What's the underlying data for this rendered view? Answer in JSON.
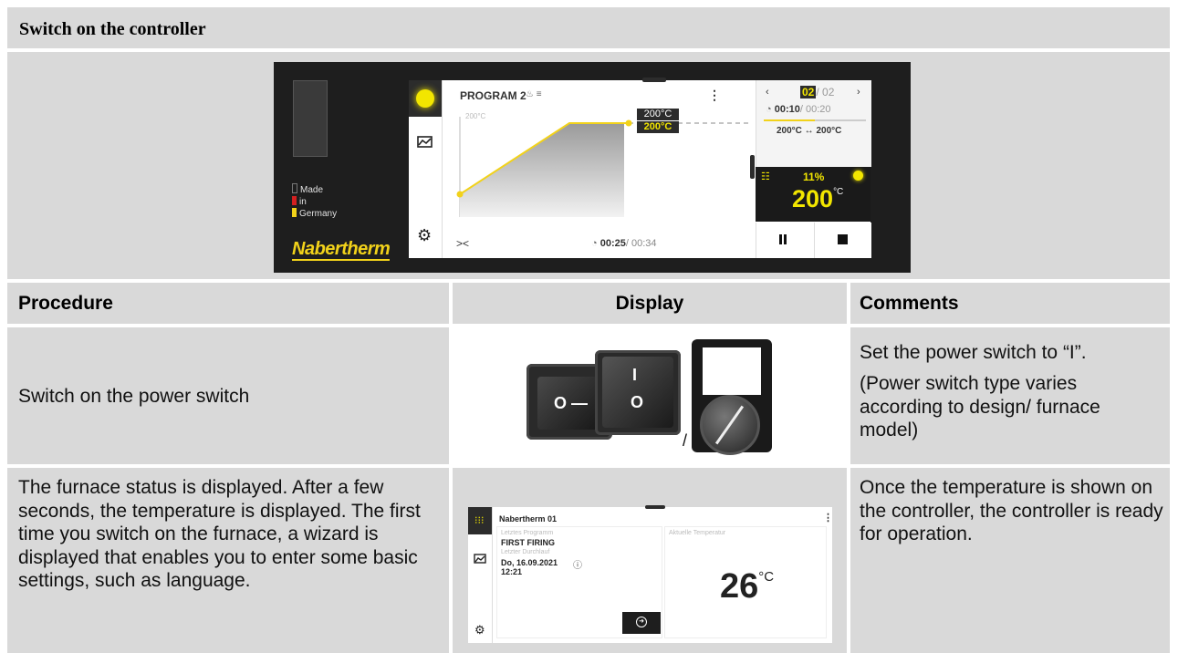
{
  "section_title": "Switch on the controller",
  "controller": {
    "brand_lines": [
      {
        "text": "Made",
        "color": "#1e1e1e"
      },
      {
        "text": "in",
        "color": "#d32020"
      },
      {
        "text": "Germany",
        "color": "#f2d21a"
      }
    ],
    "logo": "Nabertherm",
    "program_title": "PROGRAM 2",
    "axis_label": "200°C",
    "setpoint": "200°C",
    "actual": "200°C",
    "segment_current": "02",
    "segment_total": "/ 02",
    "segment_time": "00:10",
    "segment_time_total": "/ 00:20",
    "segment_temp_range": "200°C ↔ 200°C",
    "program_time": "00:25",
    "program_time_total": "/ 00:34",
    "power_percent": "11%",
    "big_temp": "200",
    "big_temp_unit": "°C",
    "accent": "#f2e600"
  },
  "table": {
    "headers": {
      "procedure": "Procedure",
      "display": "Display",
      "comments": "Comments"
    },
    "rows": [
      {
        "procedure": "Switch on the power switch",
        "comments": [
          "Set the power switch to “I”.",
          "(Power switch type varies according to design/ furnace model)"
        ],
        "switch_separator": "/",
        "rocker_off_label": "O —",
        "rocker_on_label_top": "I",
        "rocker_on_label_bottom": "O"
      },
      {
        "procedure": "The furnace status is displayed. After a few seconds, the temperature is displayed. The first time you switch on the furnace, a wizard is displayed that enables you to enter some basic settings, such as language.",
        "comments": "Once the temperature is shown on the controller, the controller is ready for operation.",
        "screen": {
          "title": "Nabertherm 01",
          "last_program_label": "Letztes Programm",
          "last_program": "FIRST FIRING",
          "last_run_label": "Letzter Durchlauf",
          "last_run_date": "Do, 16.09.2021",
          "last_run_time": "12:21",
          "current_temp_label": "Aktuelle Temperatur",
          "current_temp": "26",
          "current_temp_unit": "°C"
        }
      }
    ]
  }
}
